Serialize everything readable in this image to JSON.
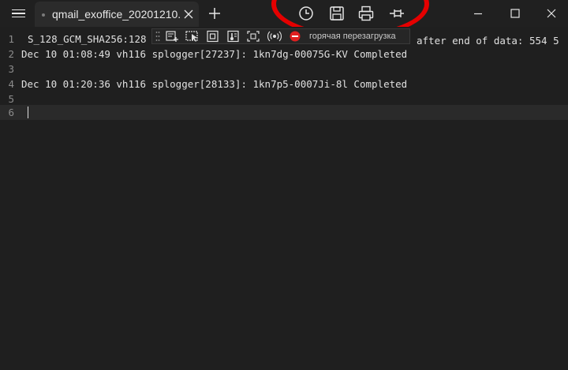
{
  "window": {
    "tab_title": "qmail_exoffice_20201210.",
    "controls": [
      "minimize-icon",
      "maximize-icon",
      "close-icon"
    ]
  },
  "toolbar": {
    "icons": [
      "history-icon",
      "save-icon",
      "print-icon",
      "pin-icon"
    ],
    "highlight_color": "#e50000"
  },
  "overlay": {
    "label": "горячая перезагрузка",
    "icons": [
      "add-window-icon",
      "pointer-icon",
      "square-icon",
      "thermometer-icon",
      "screenshot-icon",
      "radio-icon",
      "stop-icon"
    ]
  },
  "editor": {
    "lines": [
      {
        "number": "1",
        "text": "S_128_GCM_SHA256:128"
      },
      {
        "number": "2",
        "text": "Dec 10 01:08:49 vh116 splogger[27237]: 1kn7dg-00075G-KV Completed"
      },
      {
        "number": "3",
        "text": ""
      },
      {
        "number": "4",
        "text": "Dec 10 01:20:36 vh116 splogger[28133]: 1kn7p5-0007Ji-8l Completed"
      },
      {
        "number": "5",
        "text": ""
      },
      {
        "number": "6",
        "text": ""
      }
    ],
    "line1_tail": "after end of data: 554 5",
    "current_line": 6
  }
}
